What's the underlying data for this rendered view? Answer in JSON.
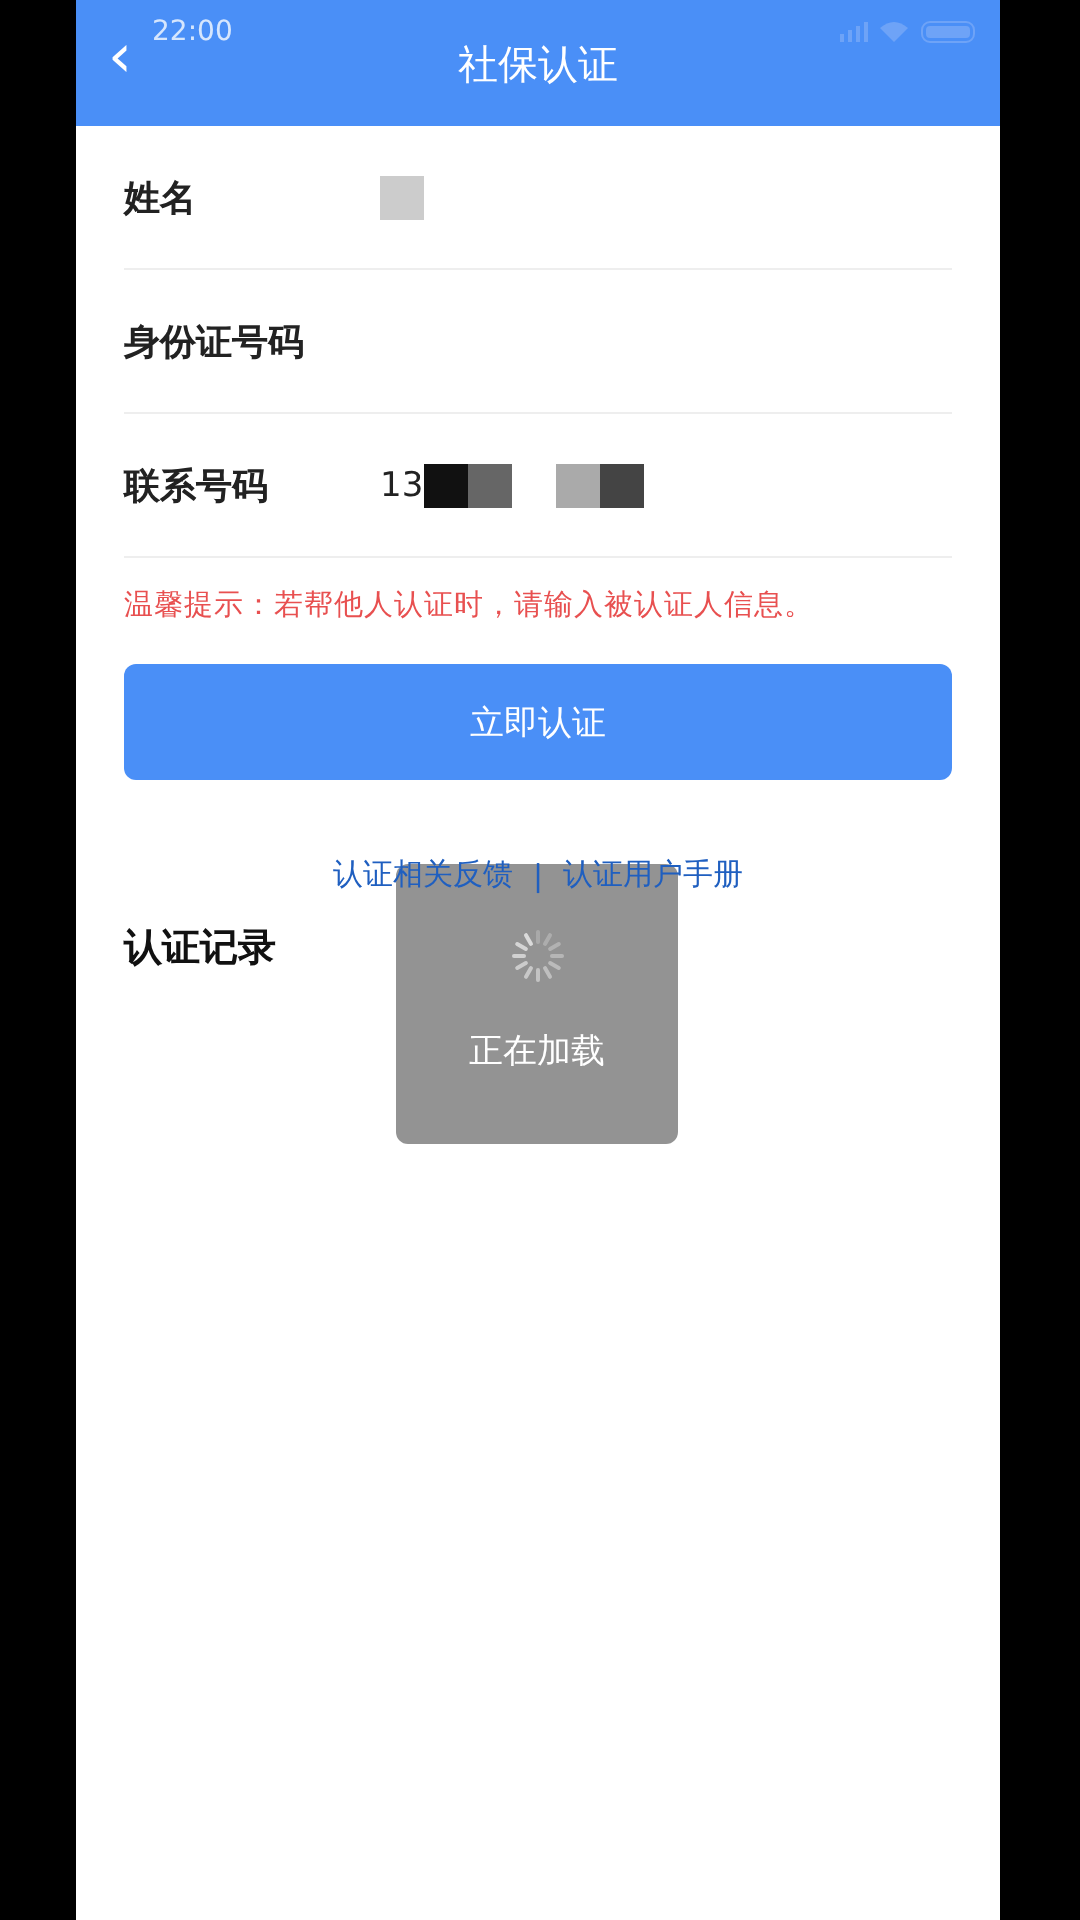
{
  "status_bar": {
    "time": "22:00"
  },
  "header": {
    "back": "‹",
    "title": "社保认证"
  },
  "form": {
    "fields": [
      {
        "label": "姓名",
        "kind": "redacted"
      },
      {
        "label": "身份证号码",
        "kind": "redacted"
      },
      {
        "label": "联系号码",
        "kind": "phone",
        "value": "13"
      }
    ]
  },
  "tip": "温馨提示：若帮他人认证时，请输入被认证人信息。",
  "submit_button": "立即认证",
  "links": [
    {
      "label": "认证相关反馈"
    },
    {
      "label": "认证用户手册"
    }
  ],
  "link_separator": "|",
  "records": {
    "title": "认证记录"
  },
  "loading": {
    "text": "正在加载"
  }
}
